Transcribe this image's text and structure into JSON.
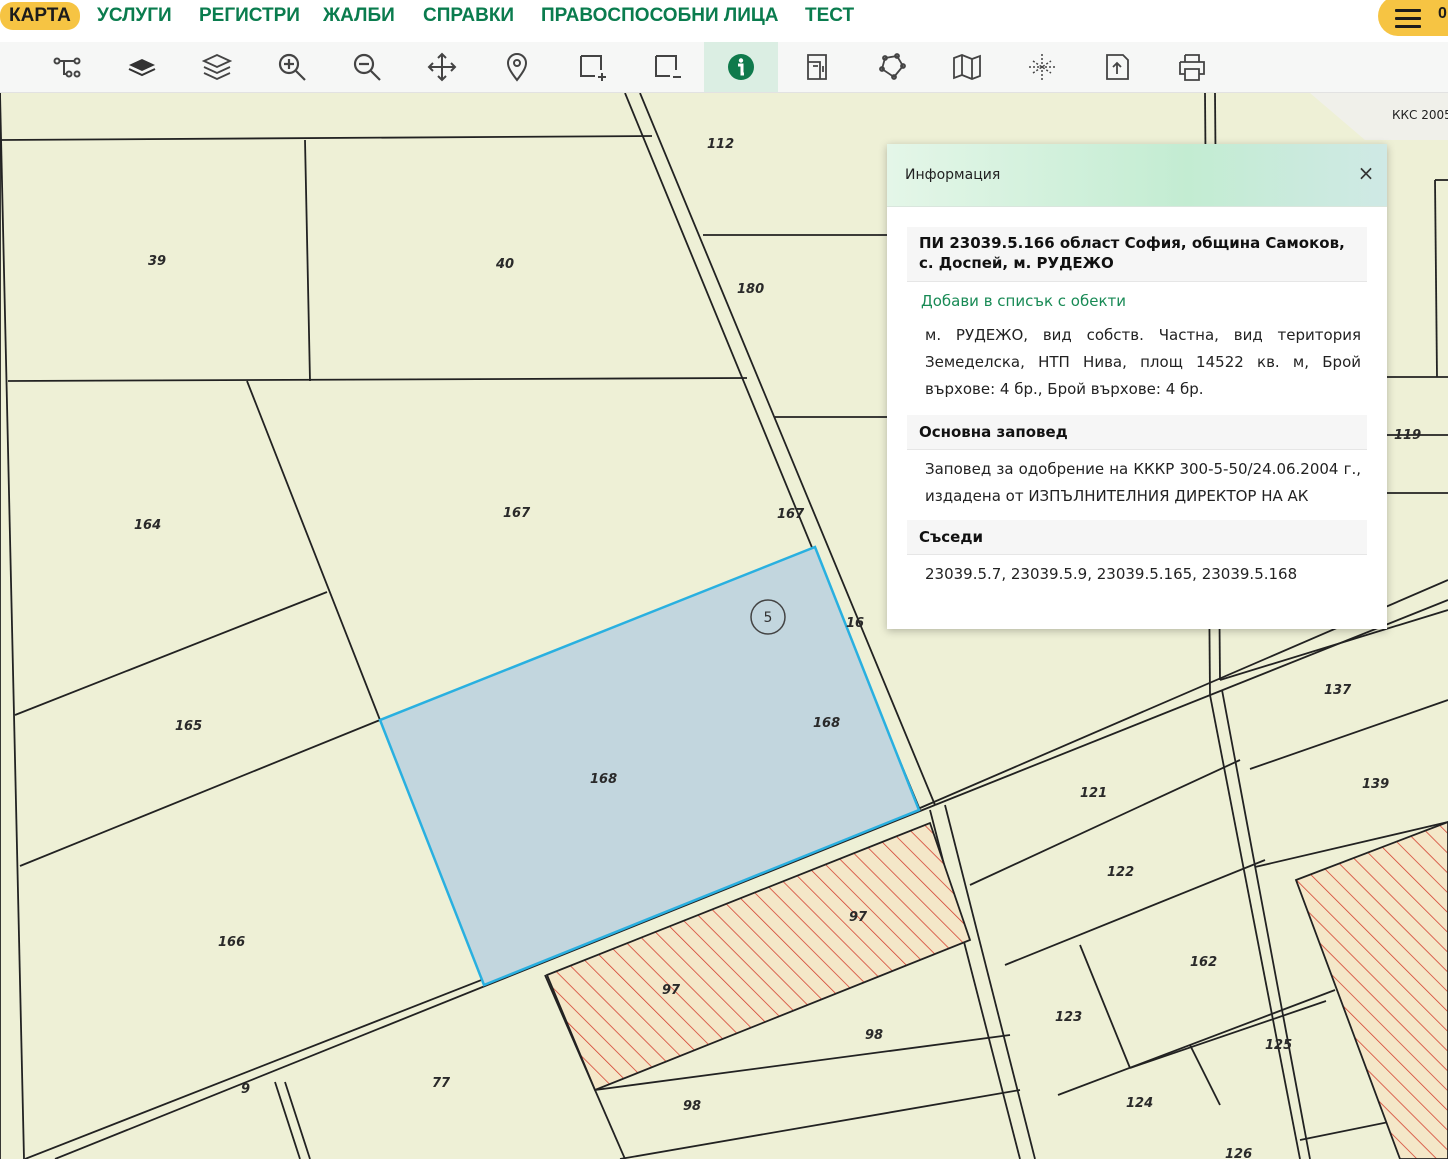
{
  "nav": {
    "items": [
      "КАРТА",
      "УСЛУГИ",
      "РЕГИСТРИ",
      "ЖАЛБИ",
      "СПРАВКИ",
      "ПРАВОСПОСОБНИ ЛИЦА",
      "ТЕСТ"
    ],
    "active": "КАРТА",
    "menu_badge": "0"
  },
  "toolbar": {
    "tools": [
      "measure-route-icon",
      "layer-single-icon",
      "layers-icon",
      "zoom-in-icon",
      "zoom-out-icon",
      "pan-icon",
      "location-pin-icon",
      "add-rectangle-icon",
      "remove-rectangle-icon",
      "info-icon",
      "edit-document-icon",
      "polygon-icon",
      "map-icon",
      "grid-icon",
      "export-icon",
      "print-icon"
    ],
    "active_tool": "info-icon"
  },
  "map": {
    "crs_label": "ККС 2005",
    "selected_parcel_label": "168",
    "circle_badge": "5",
    "parcel_labels": [
      "112",
      "39",
      "40",
      "180",
      "167",
      "164",
      "167",
      "16",
      "119",
      "165",
      "168",
      "137",
      "121",
      "139",
      "166",
      "122",
      "97",
      "162",
      "97",
      "123",
      "98",
      "125",
      "77",
      "98",
      "124",
      "9",
      "126"
    ]
  },
  "popup": {
    "title": "Информация",
    "close_symbol": "×",
    "parcel_heading": "ПИ 23039.5.166 област София, община Самоков, с. Доспей, м. РУДЕЖО",
    "add_link": "Добави в списък с обекти",
    "description": "м. РУДЕЖО, вид собств. Частна, вид територия Земеделска, НТП Нива, площ 14522 кв. м, Брой върхове: 4 бр., Брой върхове: 4 бр.",
    "order_heading": "Основна заповед",
    "order_text": "Заповед за одобрение на КККР 300-5-50/24.06.2004 г., издадена от ИЗПЪЛНИТЕЛНИЯ ДИРЕКТОР НА АК",
    "neighbors_heading": "Съседи",
    "neighbors_text": "23039.5.7, 23039.5.9, 23039.5.165, 23039.5.168"
  },
  "colors": {
    "brand_green": "#0a7c4e",
    "accent_yellow": "#f6c443",
    "map_background": "#eef0d6",
    "selection_fill": "#c2d6de",
    "selection_stroke": "#29b0e0",
    "hatch_red": "#d23a2a"
  }
}
